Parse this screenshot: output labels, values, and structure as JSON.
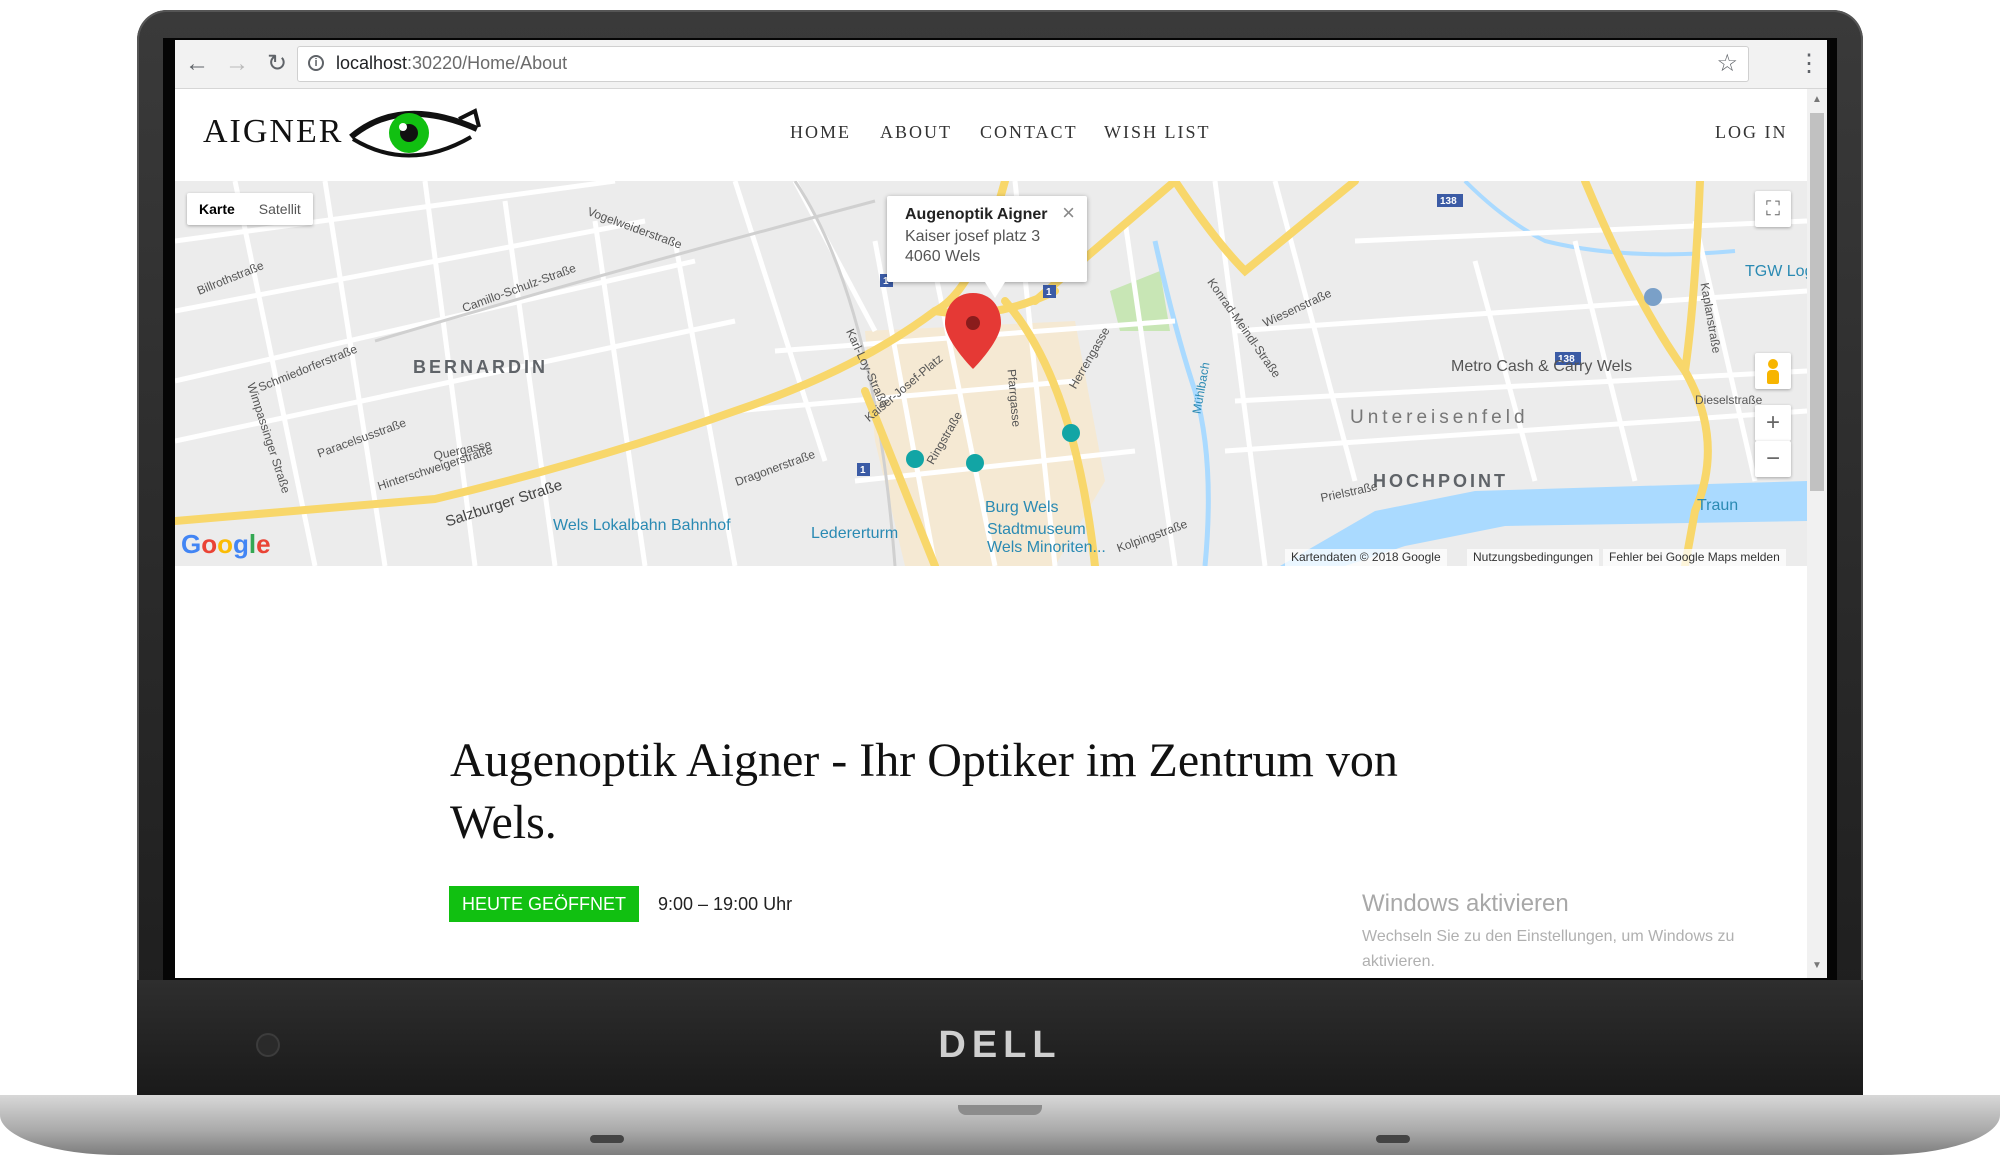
{
  "browser": {
    "url_host": "localhost",
    "url_path": ":30220/Home/About"
  },
  "site": {
    "logo_text": "AIGNER",
    "nav": [
      "HOME",
      "ABOUT",
      "CONTACT",
      "WISH LIST"
    ],
    "login": "LOG IN"
  },
  "map": {
    "type_buttons": [
      "Karte",
      "Satellit"
    ],
    "info_window": {
      "title": "Augenoptik Aigner",
      "line1": "Kaiser josef platz 3",
      "line2": "4060 Wels",
      "close": "×"
    },
    "districts": [
      "BERNARDIN",
      "Untereisenfeld",
      "HOCHPOINT"
    ],
    "pois": [
      "Wels Lokalbahn Bahnhof",
      "Ledererturm",
      "Burg Wels",
      "Stadtmuseum",
      "Wels Minoriten...",
      "Metro Cash & Carry Wels",
      "TGW Logi",
      "Traun"
    ],
    "streets": [
      "Salzburger Straße",
      "Vogelweiderstraße",
      "Dragonerstraße",
      "Wimpassinger Straße",
      "Mühlbach",
      "Hinterschweigerstraße",
      "Schmiedorferstraße",
      "Camillo-Schulz-Straße",
      "Karl-Loy-Straße",
      "Kaiser-Josef-Platz",
      "Ringstraße",
      "Pfarrgasse",
      "Herrengasse",
      "Konrad-Meindl-Straße",
      "Wiesenstraße",
      "Dieselstraße",
      "Prielstraße",
      "Kolpingstraße",
      "Kaplanstraße",
      "Billrothstraße",
      "Paracelsusstraße",
      "Quergasse"
    ],
    "road_badges": [
      "1",
      "1",
      "1",
      "138",
      "138"
    ],
    "attribution": [
      "Kartendaten © 2018 Google",
      "Nutzungsbedingungen",
      "Fehler bei Google Maps melden"
    ],
    "google_logo": "Google",
    "zoom_in": "+",
    "zoom_out": "−",
    "fullscreen": "⛶"
  },
  "content": {
    "headline": "Augenoptik Aigner - Ihr Optiker im Zentrum von Wels.",
    "open_badge": "HEUTE GEÖFFNET",
    "hours": "9:00 – 19:00 Uhr"
  },
  "watermark": {
    "title": "Windows aktivieren",
    "subtitle": "Wechseln Sie zu den Einstellungen, um Windows zu aktivieren."
  },
  "device": {
    "brand": "DELL"
  },
  "colors": {
    "accent_green": "#11c011",
    "map_road_yellow": "#f8d76b",
    "river_blue": "#aadaff",
    "marker_red": "#e53935"
  }
}
